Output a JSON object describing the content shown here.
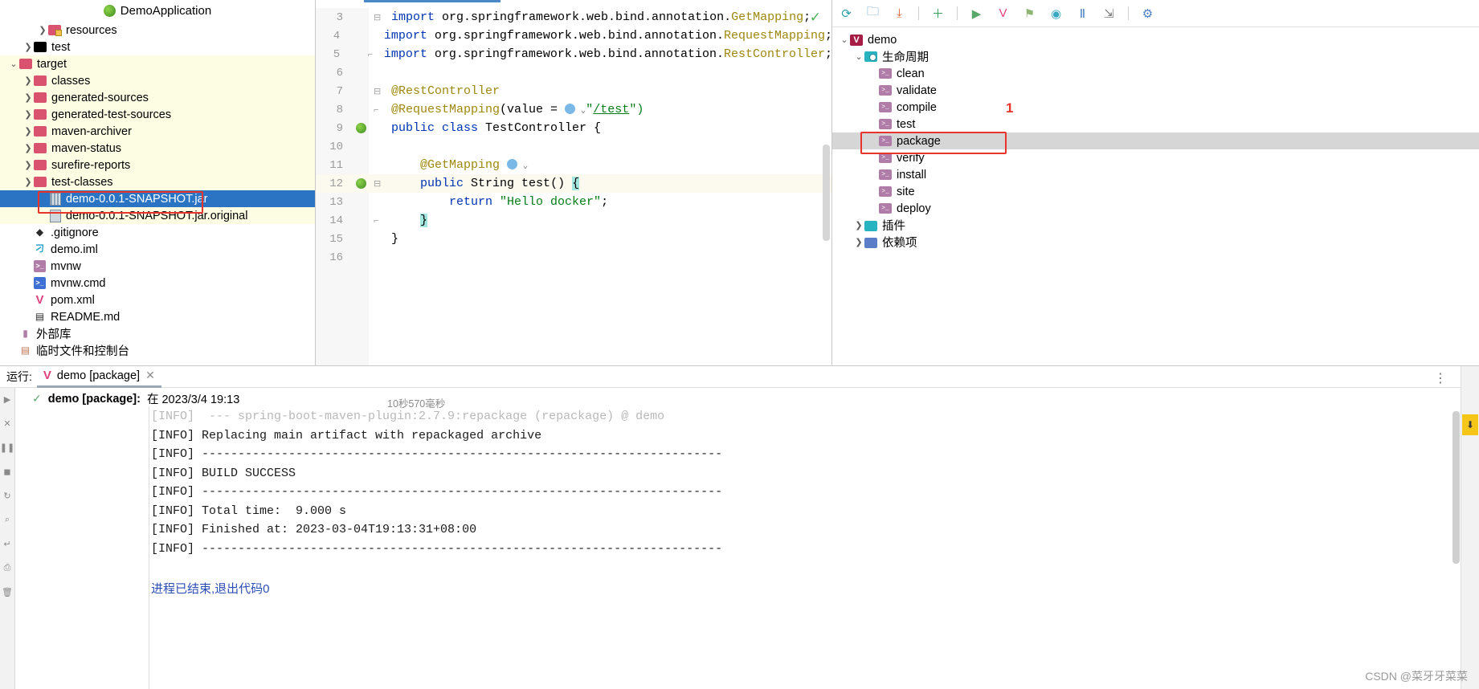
{
  "project": {
    "title": "DemoApplication",
    "title_icon": "spring-boot-icon",
    "items": [
      {
        "label": "resources",
        "arrow": "collapsed",
        "icon": "resources-folder-icon",
        "indent": 2,
        "state": "normal"
      },
      {
        "label": "test",
        "arrow": "collapsed",
        "icon": "test-folder-icon",
        "indent": 1,
        "state": "normal"
      },
      {
        "label": "target",
        "arrow": "expanded",
        "icon": "folder-icon",
        "indent": 0,
        "state": "highlight"
      },
      {
        "label": "classes",
        "arrow": "collapsed",
        "icon": "folder-icon",
        "indent": 1,
        "state": "highlight"
      },
      {
        "label": "generated-sources",
        "arrow": "collapsed",
        "icon": "folder-icon",
        "indent": 1,
        "state": "highlight"
      },
      {
        "label": "generated-test-sources",
        "arrow": "collapsed",
        "icon": "folder-icon",
        "indent": 1,
        "state": "highlight"
      },
      {
        "label": "maven-archiver",
        "arrow": "collapsed",
        "icon": "folder-icon",
        "indent": 1,
        "state": "highlight"
      },
      {
        "label": "maven-status",
        "arrow": "collapsed",
        "icon": "folder-icon",
        "indent": 1,
        "state": "highlight"
      },
      {
        "label": "surefire-reports",
        "arrow": "collapsed",
        "icon": "folder-icon",
        "indent": 1,
        "state": "highlight"
      },
      {
        "label": "test-classes",
        "arrow": "collapsed",
        "icon": "folder-icon",
        "indent": 1,
        "state": "highlight"
      },
      {
        "label": "demo-0.0.1-SNAPSHOT.jar",
        "arrow": "none",
        "icon": "jar-file-icon",
        "indent": 2,
        "state": "selected"
      },
      {
        "label": "demo-0.0.1-SNAPSHOT.jar.original",
        "arrow": "none",
        "icon": "jar-original-file-icon",
        "indent": 2,
        "state": "highlight"
      },
      {
        "label": ".gitignore",
        "arrow": "none",
        "icon": "git-icon",
        "indent": 1,
        "state": "normal"
      },
      {
        "label": "demo.iml",
        "arrow": "none",
        "icon": "iml-file-icon",
        "indent": 1,
        "state": "normal"
      },
      {
        "label": "mvnw",
        "arrow": "none",
        "icon": "shell-script-icon",
        "indent": 1,
        "state": "normal"
      },
      {
        "label": "mvnw.cmd",
        "arrow": "none",
        "icon": "cmd-script-icon",
        "indent": 1,
        "state": "normal"
      },
      {
        "label": "pom.xml",
        "arrow": "none",
        "icon": "maven-pom-icon",
        "indent": 1,
        "state": "normal"
      },
      {
        "label": "README.md",
        "arrow": "none",
        "icon": "markdown-icon",
        "indent": 1,
        "state": "normal"
      },
      {
        "label": "外部库",
        "arrow": "none",
        "icon": "external-libraries-icon",
        "indent": 0,
        "state": "normal"
      },
      {
        "label": "临时文件和控制台",
        "arrow": "none",
        "icon": "scratches-console-icon",
        "indent": 0,
        "state": "normal"
      }
    ]
  },
  "editor": {
    "lines": [
      {
        "num": "3",
        "fold": "start",
        "gicon": false,
        "tokens": [
          {
            "t": "import ",
            "c": "kw"
          },
          {
            "t": "org.springframework.web.bind.annotation.",
            "c": "pl"
          },
          {
            "t": "GetMapping",
            "c": "ann"
          },
          {
            "t": ";",
            "c": "pl"
          }
        ]
      },
      {
        "num": "4",
        "fold": "",
        "gicon": false,
        "tokens": [
          {
            "t": "import ",
            "c": "kw"
          },
          {
            "t": "org.springframework.web.bind.annotation.",
            "c": "pl"
          },
          {
            "t": "RequestMapping",
            "c": "ann"
          },
          {
            "t": ";",
            "c": "pl"
          }
        ]
      },
      {
        "num": "5",
        "fold": "end",
        "gicon": false,
        "tokens": [
          {
            "t": "import ",
            "c": "kw"
          },
          {
            "t": "org.springframework.web.bind.annotation.",
            "c": "pl"
          },
          {
            "t": "RestController",
            "c": "ann"
          },
          {
            "t": ";",
            "c": "pl"
          }
        ]
      },
      {
        "num": "6",
        "fold": "",
        "gicon": false,
        "tokens": []
      },
      {
        "num": "7",
        "fold": "start",
        "gicon": false,
        "tokens": [
          {
            "t": "@RestController",
            "c": "ann"
          }
        ]
      },
      {
        "num": "8",
        "fold": "end",
        "gicon": false,
        "tokens": [
          {
            "t": "@RequestMapping",
            "c": "ann"
          },
          {
            "t": "(value = ",
            "c": "pl"
          },
          {
            "t": "@WEB",
            "c": "web"
          },
          {
            "t": "\"",
            "c": "str"
          },
          {
            "t": "/test",
            "c": "link"
          },
          {
            "t": "\")",
            "c": "str"
          }
        ]
      },
      {
        "num": "9",
        "fold": "",
        "gicon": true,
        "tokens": [
          {
            "t": "public class ",
            "c": "kw"
          },
          {
            "t": "TestController {",
            "c": "pl"
          }
        ]
      },
      {
        "num": "10",
        "fold": "",
        "gicon": false,
        "tokens": []
      },
      {
        "num": "11",
        "fold": "",
        "gicon": false,
        "tokens": [
          {
            "t": "    @GetMapping ",
            "c": "ann"
          },
          {
            "t": "@WEB",
            "c": "web"
          }
        ]
      },
      {
        "num": "12",
        "fold": "start2",
        "gicon": true,
        "current": true,
        "tokens": [
          {
            "t": "    public ",
            "c": "kw"
          },
          {
            "t": "String ",
            "c": "pl"
          },
          {
            "t": "test",
            "c": "pl"
          },
          {
            "t": "() ",
            "c": "pl"
          },
          {
            "t": "{",
            "c": "hlbrace"
          }
        ]
      },
      {
        "num": "13",
        "fold": "",
        "gicon": false,
        "tokens": [
          {
            "t": "        return ",
            "c": "kw"
          },
          {
            "t": "\"Hello docker\"",
            "c": "str"
          },
          {
            "t": ";",
            "c": "pl"
          }
        ]
      },
      {
        "num": "14",
        "fold": "end2",
        "gicon": false,
        "tokens": [
          {
            "t": "    ",
            "c": "pl"
          },
          {
            "t": "}",
            "c": "hlbrace"
          }
        ]
      },
      {
        "num": "15",
        "fold": "",
        "gicon": false,
        "tokens": [
          {
            "t": "}",
            "c": "pl"
          }
        ]
      },
      {
        "num": "16",
        "fold": "",
        "gicon": false,
        "tokens": []
      }
    ],
    "inspection_status": "ok-check-icon"
  },
  "maven": {
    "toolbar": [
      {
        "name": "reload-all-maven-projects-icon",
        "glyph": "⟳",
        "color": "#2a9ea8"
      },
      {
        "name": "add-maven-project-folder-icon",
        "glyph": "🗀",
        "color": "#3c7fc4"
      },
      {
        "name": "download-sources-icon",
        "glyph": "⤓",
        "color": "#d4622a"
      },
      {
        "name": "separator",
        "glyph": "",
        "color": ""
      },
      {
        "name": "add-icon",
        "glyph": "＋",
        "color": "#3aa05a"
      },
      {
        "name": "separator",
        "glyph": "",
        "color": ""
      },
      {
        "name": "run-icon",
        "glyph": "▶",
        "color": "#59a869"
      },
      {
        "name": "execute-maven-goal-icon",
        "glyph": "V",
        "color": "#e0417e"
      },
      {
        "name": "toggle-offline-mode-icon",
        "glyph": "⚑",
        "color": "#8fb573"
      },
      {
        "name": "toggle-skip-tests-icon",
        "glyph": "◉",
        "color": "#3aa8c4"
      },
      {
        "name": "show-dependencies-icon",
        "glyph": "Ⅱ",
        "color": "#4a7fc4"
      },
      {
        "name": "expand-collapse-icon",
        "glyph": "⇲",
        "color": "#7a7a7a"
      },
      {
        "name": "separator",
        "glyph": "",
        "color": ""
      },
      {
        "name": "maven-settings-gear-icon",
        "glyph": "⚙",
        "color": "#4a7fc4"
      }
    ],
    "tree": [
      {
        "label": "demo",
        "arrow": "expanded",
        "icon": "maven-project-icon",
        "indent": 0,
        "state": "normal"
      },
      {
        "label": "生命周期",
        "arrow": "expanded",
        "icon": "lifecycle-folder-icon",
        "indent": 1,
        "state": "normal"
      },
      {
        "label": "clean",
        "arrow": "none",
        "icon": "maven-goal-icon",
        "indent": 2,
        "state": "normal"
      },
      {
        "label": "validate",
        "arrow": "none",
        "icon": "maven-goal-icon",
        "indent": 2,
        "state": "normal"
      },
      {
        "label": "compile",
        "arrow": "none",
        "icon": "maven-goal-icon",
        "indent": 2,
        "state": "normal"
      },
      {
        "label": "test",
        "arrow": "none",
        "icon": "maven-goal-icon",
        "indent": 2,
        "state": "normal"
      },
      {
        "label": "package",
        "arrow": "none",
        "icon": "maven-goal-icon",
        "indent": 2,
        "state": "selected"
      },
      {
        "label": "verify",
        "arrow": "none",
        "icon": "maven-goal-icon",
        "indent": 2,
        "state": "normal"
      },
      {
        "label": "install",
        "arrow": "none",
        "icon": "maven-goal-icon",
        "indent": 2,
        "state": "normal"
      },
      {
        "label": "site",
        "arrow": "none",
        "icon": "maven-goal-icon",
        "indent": 2,
        "state": "normal"
      },
      {
        "label": "deploy",
        "arrow": "none",
        "icon": "maven-goal-icon",
        "indent": 2,
        "state": "normal"
      },
      {
        "label": "插件",
        "arrow": "collapsed",
        "icon": "plugins-folder-icon",
        "indent": 1,
        "state": "normal"
      },
      {
        "label": "依赖项",
        "arrow": "collapsed",
        "icon": "dependencies-folder-icon",
        "indent": 1,
        "state": "normal"
      }
    ],
    "annotation_badge": "1"
  },
  "run_panel": {
    "label": "运行:",
    "tab_title": "demo [package]",
    "tab_icon": "maven-run-icon",
    "close_icon": "close-icon",
    "header_title": "demo [package]:",
    "header_suffix": "在 2023/3/4 19:13",
    "header_icon": "success-check-icon",
    "duration": "10秒570毫秒",
    "console_lines": [
      {
        "text": "[INFO]  --- spring-boot-maven-plugin:2.7.9:repackage (repackage) @ demo",
        "style": "cut"
      },
      {
        "text": "[INFO] Replacing main artifact with repackaged archive",
        "style": "normal"
      },
      {
        "text": "[INFO] ------------------------------------------------------------------------",
        "style": "normal"
      },
      {
        "text": "[INFO] BUILD SUCCESS",
        "style": "normal"
      },
      {
        "text": "[INFO] ------------------------------------------------------------------------",
        "style": "normal"
      },
      {
        "text": "[INFO] Total time:  9.000 s",
        "style": "normal"
      },
      {
        "text": "[INFO] Finished at: 2023-03-04T19:13:31+08:00",
        "style": "normal"
      },
      {
        "text": "[INFO] ------------------------------------------------------------------------",
        "style": "normal"
      },
      {
        "text": "",
        "style": "normal"
      },
      {
        "text": "进程已结束,退出代码0",
        "style": "zh"
      }
    ],
    "more_icon": "more-options-icon",
    "download_icon": "download-indicator-icon"
  },
  "watermark": "CSDN @菜牙牙菜菜"
}
